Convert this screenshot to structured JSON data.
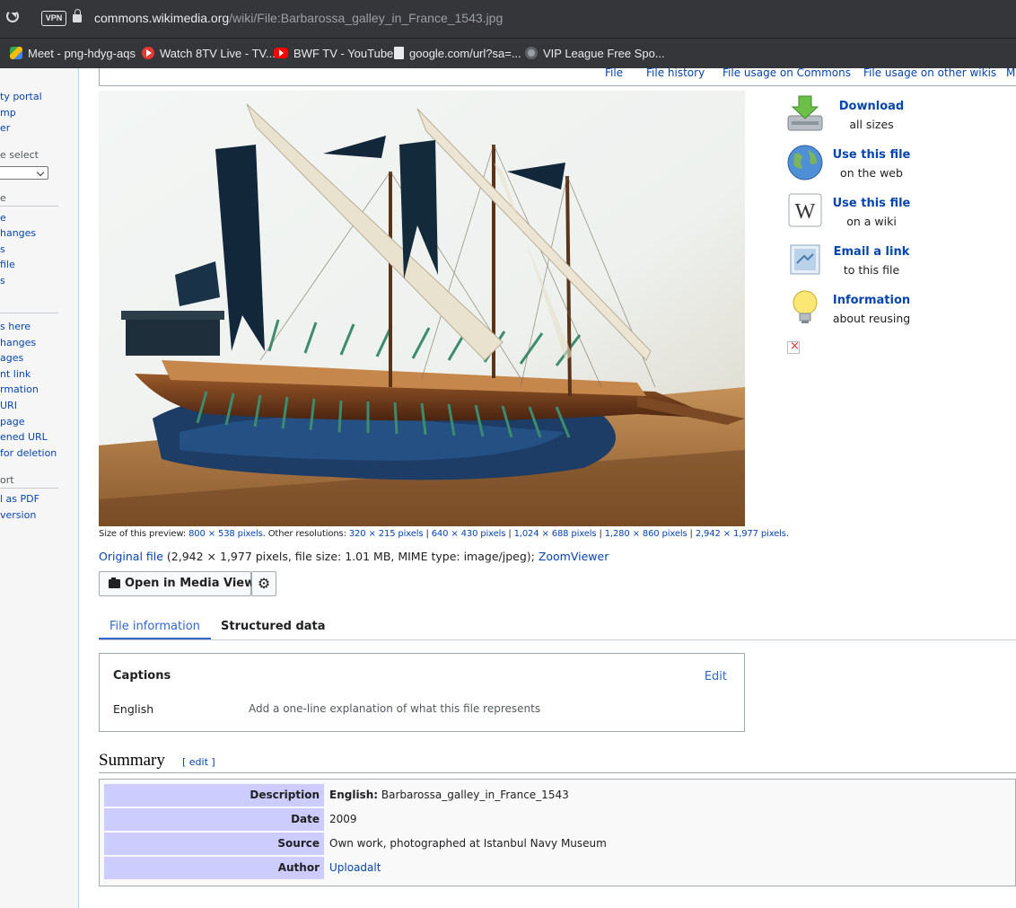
{
  "browser": {
    "vpn_label": "VPN",
    "url_domain": "commons.wikimedia.org",
    "url_path": "/wiki/File:Barbarossa_galley_in_France_1543.jpg",
    "bookmarks": [
      {
        "label": "Meet - png-hdyg-aqs",
        "icon": "meet-icon"
      },
      {
        "label": "Watch 8TV Live - TV...",
        "icon": "play-icon"
      },
      {
        "label": "BWF TV - YouTube",
        "icon": "youtube-icon"
      },
      {
        "label": "google.com/url?sa=...",
        "icon": "document-icon"
      },
      {
        "label": "VIP League Free Spo...",
        "icon": "vip-icon"
      }
    ]
  },
  "sidebar": {
    "items": [
      {
        "label": "ty portal",
        "type": "link"
      },
      {
        "label": "mp",
        "type": "link"
      },
      {
        "label": "er",
        "type": "link"
      },
      {
        "label": "e select",
        "type": "head"
      },
      {
        "label": "e",
        "type": "head"
      },
      {
        "label": "e",
        "type": "link"
      },
      {
        "label": "hanges",
        "type": "link"
      },
      {
        "label": "s",
        "type": "link"
      },
      {
        "label": "file",
        "type": "link"
      },
      {
        "label": "s",
        "type": "link"
      },
      {
        "label": "s here",
        "type": "link"
      },
      {
        "label": "hanges",
        "type": "link"
      },
      {
        "label": "ages",
        "type": "link"
      },
      {
        "label": "nt link",
        "type": "link"
      },
      {
        "label": "rmation",
        "type": "link"
      },
      {
        "label": "URI",
        "type": "link"
      },
      {
        "label": "page",
        "type": "link"
      },
      {
        "label": "ened URL",
        "type": "link"
      },
      {
        "label": "for deletion",
        "type": "link"
      },
      {
        "label": "ort",
        "type": "head"
      },
      {
        "label": "l as PDF",
        "type": "link"
      },
      {
        "label": "version",
        "type": "link"
      }
    ]
  },
  "file_tabs": [
    "File",
    "File history",
    "File usage on Commons",
    "File usage on other wikis",
    "Me"
  ],
  "preview": {
    "size_label": "Size of this preview:",
    "size_value": "800 × 538 pixels",
    "other_label": ". Other resolutions:",
    "resolutions": [
      "320 × 215 pixels",
      "640 × 430 pixels",
      "1,024 × 688 pixels",
      "1,280 × 860 pixels",
      "2,942 × 1,977 pixels"
    ],
    "trailing": "."
  },
  "original": {
    "link": "Original file",
    "details": " (2,942 × 1,977 pixels, file size: 1.01 MB, MIME type: image/jpeg); ",
    "zoom": "ZoomViewer"
  },
  "media_viewer_label": "Open in Media Viewer",
  "tabs": {
    "file_information": "File information",
    "structured_data": "Structured data"
  },
  "captions": {
    "title": "Captions",
    "edit": "Edit",
    "language": "English",
    "placeholder": "Add a one-line explanation of what this file represents"
  },
  "summary": {
    "title": "Summary",
    "edit": "[ edit ]",
    "rows": [
      {
        "label": "Description",
        "value_prefix": "English:",
        "value": " Barbarossa_galley_in_France_1543"
      },
      {
        "label": "Date",
        "value": "2009"
      },
      {
        "label": "Source",
        "value": "Own work, photographed at Istanbul Navy Museum"
      },
      {
        "label": "Author",
        "value": "Uploadalt"
      }
    ]
  },
  "actions": [
    {
      "title": "Download",
      "subtitle": "all sizes",
      "icon": "download-icon"
    },
    {
      "title": "Use this file",
      "subtitle": "on the web",
      "icon": "globe-icon"
    },
    {
      "title": "Use this file",
      "subtitle": "on a wiki",
      "icon": "wikipedia-icon"
    },
    {
      "title": "Email a link",
      "subtitle": "to this file",
      "icon": "email-icon"
    },
    {
      "title": "Information",
      "subtitle": "about reusing",
      "icon": "lightbulb-icon"
    }
  ],
  "colors": {
    "link": "#0645ad",
    "accent": "#3366cc",
    "infobox_label": "#ccccff",
    "chrome": "#35363a"
  }
}
